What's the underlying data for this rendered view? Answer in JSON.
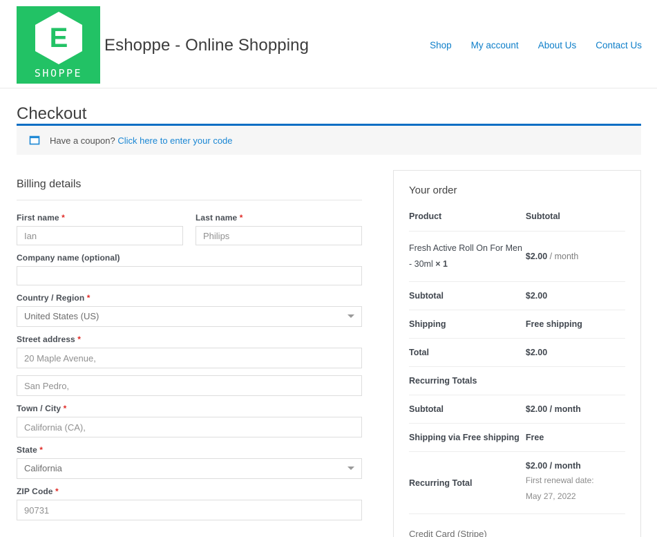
{
  "header": {
    "logo": {
      "mark_letter": "E",
      "wordmark": "SHOPPE",
      "bg_color": "#22c265"
    },
    "site_title": "Eshoppe - Online Shopping",
    "nav": [
      {
        "label": "Shop"
      },
      {
        "label": "My account"
      },
      {
        "label": "About Us"
      },
      {
        "label": "Contact Us"
      }
    ],
    "link_color": "#0d7ec9"
  },
  "page": {
    "title": "Checkout"
  },
  "coupon": {
    "icon": "coupon-tag-icon",
    "prompt": "Have a coupon?",
    "link_label": "Click here to enter your code",
    "accent_color": "#0b6ec4",
    "bg_color": "#f6f6f6"
  },
  "billing": {
    "heading": "Billing details",
    "required_mark": "*",
    "fields": {
      "first_name": {
        "label": "First name",
        "value": "Ian",
        "required": true
      },
      "last_name": {
        "label": "Last name",
        "value": "Philips",
        "required": true
      },
      "company": {
        "label": "Company name (optional)",
        "value": "",
        "required": false
      },
      "country": {
        "label": "Country / Region",
        "value": "United States (US)",
        "required": true
      },
      "street_address": {
        "label": "Street address",
        "value": "20 Maple Avenue,",
        "required": true
      },
      "street_address_2": {
        "label": "",
        "value": "San Pedro,",
        "required": false
      },
      "city": {
        "label": "Town / City",
        "value": "California (CA),",
        "required": true
      },
      "state": {
        "label": "State",
        "value": "California",
        "required": true
      },
      "zip": {
        "label": "ZIP Code",
        "value": "90731",
        "required": true
      }
    }
  },
  "order": {
    "heading": "Your order",
    "columns": {
      "product": "Product",
      "subtotal": "Subtotal"
    },
    "line_item": {
      "name": "Fresh Active Roll On For Men - 30ml",
      "quantity": "× 1",
      "price": "$2.00",
      "period": "/ month"
    },
    "rows": [
      {
        "label": "Subtotal",
        "value": "$2.00"
      },
      {
        "label": "Shipping",
        "value": "Free shipping"
      },
      {
        "label": "Total",
        "value": "$2.00"
      }
    ],
    "recurring_heading": "Recurring Totals",
    "recurring_rows": [
      {
        "label": "Subtotal",
        "value": "$2.00 / month"
      },
      {
        "label": "Shipping via Free shipping",
        "value": "Free"
      }
    ],
    "recurring_total": {
      "label": "Recurring Total",
      "value": "$2.00 / month",
      "note": "First renewal date: May 27, 2022"
    },
    "payment_method": "Credit Card (Stripe)"
  }
}
